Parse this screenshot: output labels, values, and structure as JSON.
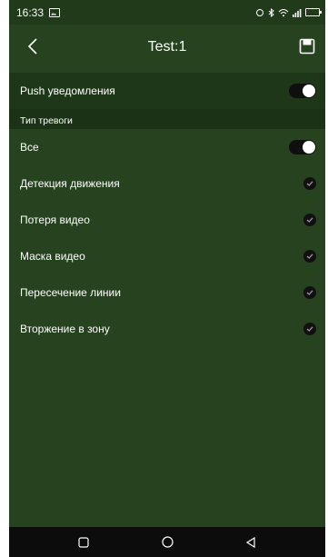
{
  "status_bar": {
    "time": "16:33",
    "signal_text": "\"–’"
  },
  "header": {
    "title": "Test:1"
  },
  "push": {
    "label": "Push уведомления",
    "enabled": true
  },
  "alarm_section": {
    "title": "Тип тревоги",
    "items": [
      {
        "label": "Все",
        "control": "toggle",
        "enabled": true
      },
      {
        "label": "Детекция движения",
        "control": "check",
        "checked": true
      },
      {
        "label": "Потеря видео",
        "control": "check",
        "checked": true
      },
      {
        "label": "Маска видео",
        "control": "check",
        "checked": true
      },
      {
        "label": "Пересечение линии",
        "control": "check",
        "checked": true
      },
      {
        "label": "Вторжение в зону",
        "control": "check",
        "checked": true
      }
    ]
  },
  "nav": {
    "buttons": [
      "recent-apps",
      "home",
      "back"
    ]
  },
  "colors": {
    "background": "#27421f",
    "status_bar": "#213a1a",
    "push_row": "#1f3719",
    "section_header": "#1c3216",
    "nav_bar": "#0c0c0c",
    "toggle_track": "#0f0f0f",
    "text": "#ffffff"
  },
  "icons": {
    "back": "chevron-left-icon",
    "save": "save-icon",
    "check": "check-circle-icon",
    "gallery": "gallery-icon",
    "battery": "battery-icon"
  }
}
